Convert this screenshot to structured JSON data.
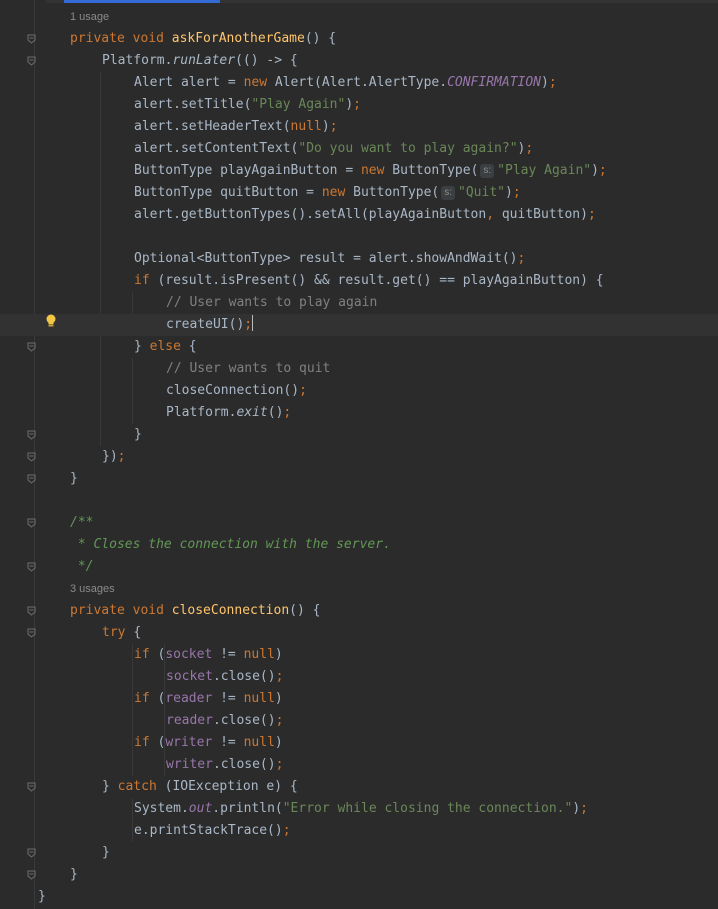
{
  "code": [
    {
      "hint": "1 usage"
    },
    {
      "t": [
        {
          "c": "kw",
          "v": "private void "
        },
        {
          "c": "fn",
          "v": "askForAnotherGame"
        },
        {
          "v": "() {"
        }
      ]
    },
    {
      "t": [
        {
          "v": "Platform."
        },
        {
          "c": "stat",
          "v": "runLater"
        },
        {
          "v": "(() -> {"
        }
      ]
    },
    {
      "t": [
        {
          "v": "Alert alert = "
        },
        {
          "c": "kw",
          "v": "new "
        },
        {
          "v": "Alert(Alert.AlertType."
        },
        {
          "c": "const",
          "v": "CONFIRMATION"
        },
        {
          "v": ")"
        },
        {
          "c": "kw",
          "v": ";"
        }
      ]
    },
    {
      "t": [
        {
          "v": "alert.setTitle("
        },
        {
          "c": "str",
          "v": "\"Play Again\""
        },
        {
          "v": ")"
        },
        {
          "c": "kw",
          "v": ";"
        }
      ]
    },
    {
      "t": [
        {
          "v": "alert.setHeaderText("
        },
        {
          "c": "kw",
          "v": "null"
        },
        {
          "v": ")"
        },
        {
          "c": "kw",
          "v": ";"
        }
      ]
    },
    {
      "t": [
        {
          "v": "alert.setContentText("
        },
        {
          "c": "str",
          "v": "\"Do you want to play again?\""
        },
        {
          "v": ")"
        },
        {
          "c": "kw",
          "v": ";"
        }
      ]
    },
    {
      "t": [
        {
          "v": "ButtonType playAgainButton = "
        },
        {
          "c": "kw",
          "v": "new "
        },
        {
          "v": "ButtonType("
        },
        {
          "c": "chip",
          "v": "s:"
        },
        {
          "c": "str",
          "v": "\"Play Again\""
        },
        {
          "v": ")"
        },
        {
          "c": "kw",
          "v": ";"
        }
      ]
    },
    {
      "t": [
        {
          "v": "ButtonType quitButton = "
        },
        {
          "c": "kw",
          "v": "new "
        },
        {
          "v": "ButtonType("
        },
        {
          "c": "chip",
          "v": "s:"
        },
        {
          "c": "str",
          "v": "\"Quit\""
        },
        {
          "v": ")"
        },
        {
          "c": "kw",
          "v": ";"
        }
      ]
    },
    {
      "t": [
        {
          "v": "alert.getButtonTypes().setAll(playAgainButton"
        },
        {
          "c": "kw",
          "v": ", "
        },
        {
          "v": "quitButton)"
        },
        {
          "c": "kw",
          "v": ";"
        }
      ]
    },
    {
      "t": []
    },
    {
      "t": [
        {
          "v": "Optional<ButtonType> result = alert.showAndWait()"
        },
        {
          "c": "kw",
          "v": ";"
        }
      ]
    },
    {
      "t": [
        {
          "c": "kw",
          "v": "if "
        },
        {
          "v": "(result.isPresent() && result.get() == playAgainButton) {"
        }
      ]
    },
    {
      "t": [
        {
          "c": "cmt",
          "v": "// User wants to play again"
        }
      ]
    },
    {
      "t": [
        {
          "v": "createUI()"
        },
        {
          "c": "kw",
          "v": ";"
        }
      ]
    },
    {
      "t": [
        {
          "v": "} "
        },
        {
          "c": "kw",
          "v": "else "
        },
        {
          "v": "{"
        }
      ]
    },
    {
      "t": [
        {
          "c": "cmt",
          "v": "// User wants to quit"
        }
      ]
    },
    {
      "t": [
        {
          "v": "closeConnection()"
        },
        {
          "c": "kw",
          "v": ";"
        }
      ]
    },
    {
      "t": [
        {
          "v": "Platform."
        },
        {
          "c": "stat",
          "v": "exit"
        },
        {
          "v": "()"
        },
        {
          "c": "kw",
          "v": ";"
        }
      ]
    },
    {
      "t": [
        {
          "v": "}"
        }
      ]
    },
    {
      "t": [
        {
          "v": "})"
        },
        {
          "c": "kw",
          "v": ";"
        }
      ]
    },
    {
      "t": [
        {
          "v": "}"
        }
      ]
    },
    {
      "t": []
    },
    {
      "t": [
        {
          "c": "doc",
          "v": "/**"
        }
      ]
    },
    {
      "t": [
        {
          "c": "doc",
          "v": " * Closes the connection with the server."
        }
      ]
    },
    {
      "t": [
        {
          "c": "doc",
          "v": " */"
        }
      ]
    },
    {
      "hint": "3 usages"
    },
    {
      "t": [
        {
          "c": "kw",
          "v": "private void "
        },
        {
          "c": "fn",
          "v": "closeConnection"
        },
        {
          "v": "() {"
        }
      ]
    },
    {
      "t": [
        {
          "c": "kw",
          "v": "try "
        },
        {
          "v": "{"
        }
      ]
    },
    {
      "t": [
        {
          "c": "kw",
          "v": "if "
        },
        {
          "v": "("
        },
        {
          "c": "fld",
          "v": "socket"
        },
        {
          "v": " != "
        },
        {
          "c": "kw",
          "v": "null"
        },
        {
          "v": ")"
        }
      ]
    },
    {
      "t": [
        {
          "c": "fld",
          "v": "socket"
        },
        {
          "v": ".close()"
        },
        {
          "c": "kw",
          "v": ";"
        }
      ]
    },
    {
      "t": [
        {
          "c": "kw",
          "v": "if "
        },
        {
          "v": "("
        },
        {
          "c": "fld",
          "v": "reader"
        },
        {
          "v": " != "
        },
        {
          "c": "kw",
          "v": "null"
        },
        {
          "v": ")"
        }
      ]
    },
    {
      "t": [
        {
          "c": "fld",
          "v": "reader"
        },
        {
          "v": ".close()"
        },
        {
          "c": "kw",
          "v": ";"
        }
      ]
    },
    {
      "t": [
        {
          "c": "kw",
          "v": "if "
        },
        {
          "v": "("
        },
        {
          "c": "fld",
          "v": "writer"
        },
        {
          "v": " != "
        },
        {
          "c": "kw",
          "v": "null"
        },
        {
          "v": ")"
        }
      ]
    },
    {
      "t": [
        {
          "c": "fld",
          "v": "writer"
        },
        {
          "v": ".close()"
        },
        {
          "c": "kw",
          "v": ";"
        }
      ]
    },
    {
      "t": [
        {
          "v": "} "
        },
        {
          "c": "kw",
          "v": "catch "
        },
        {
          "v": "(IOException e) {"
        }
      ]
    },
    {
      "t": [
        {
          "v": "System."
        },
        {
          "c": "const",
          "v": "out"
        },
        {
          "v": ".println("
        },
        {
          "c": "str",
          "v": "\"Error while closing the connection.\""
        },
        {
          "v": ")"
        },
        {
          "c": "kw",
          "v": ";"
        }
      ]
    },
    {
      "t": [
        {
          "v": "e.printStackTrace()"
        },
        {
          "c": "kw",
          "v": ";"
        }
      ]
    },
    {
      "t": [
        {
          "v": "}"
        }
      ]
    },
    {
      "t": [
        {
          "v": "}"
        }
      ]
    },
    {
      "t": [
        {
          "v": "}"
        }
      ]
    }
  ],
  "theme": {
    "background": "#2b2b2b",
    "keyword": "#cc7832",
    "method": "#ffc66d",
    "string": "#6a8759",
    "comment": "#808080",
    "doc_comment": "#629755",
    "constant": "#9876aa",
    "text": "#a9b7c6",
    "intention_bulb": "#f2c744"
  },
  "icons": {
    "intention": "lightbulb-icon",
    "fold": "fold-marker-icon"
  }
}
